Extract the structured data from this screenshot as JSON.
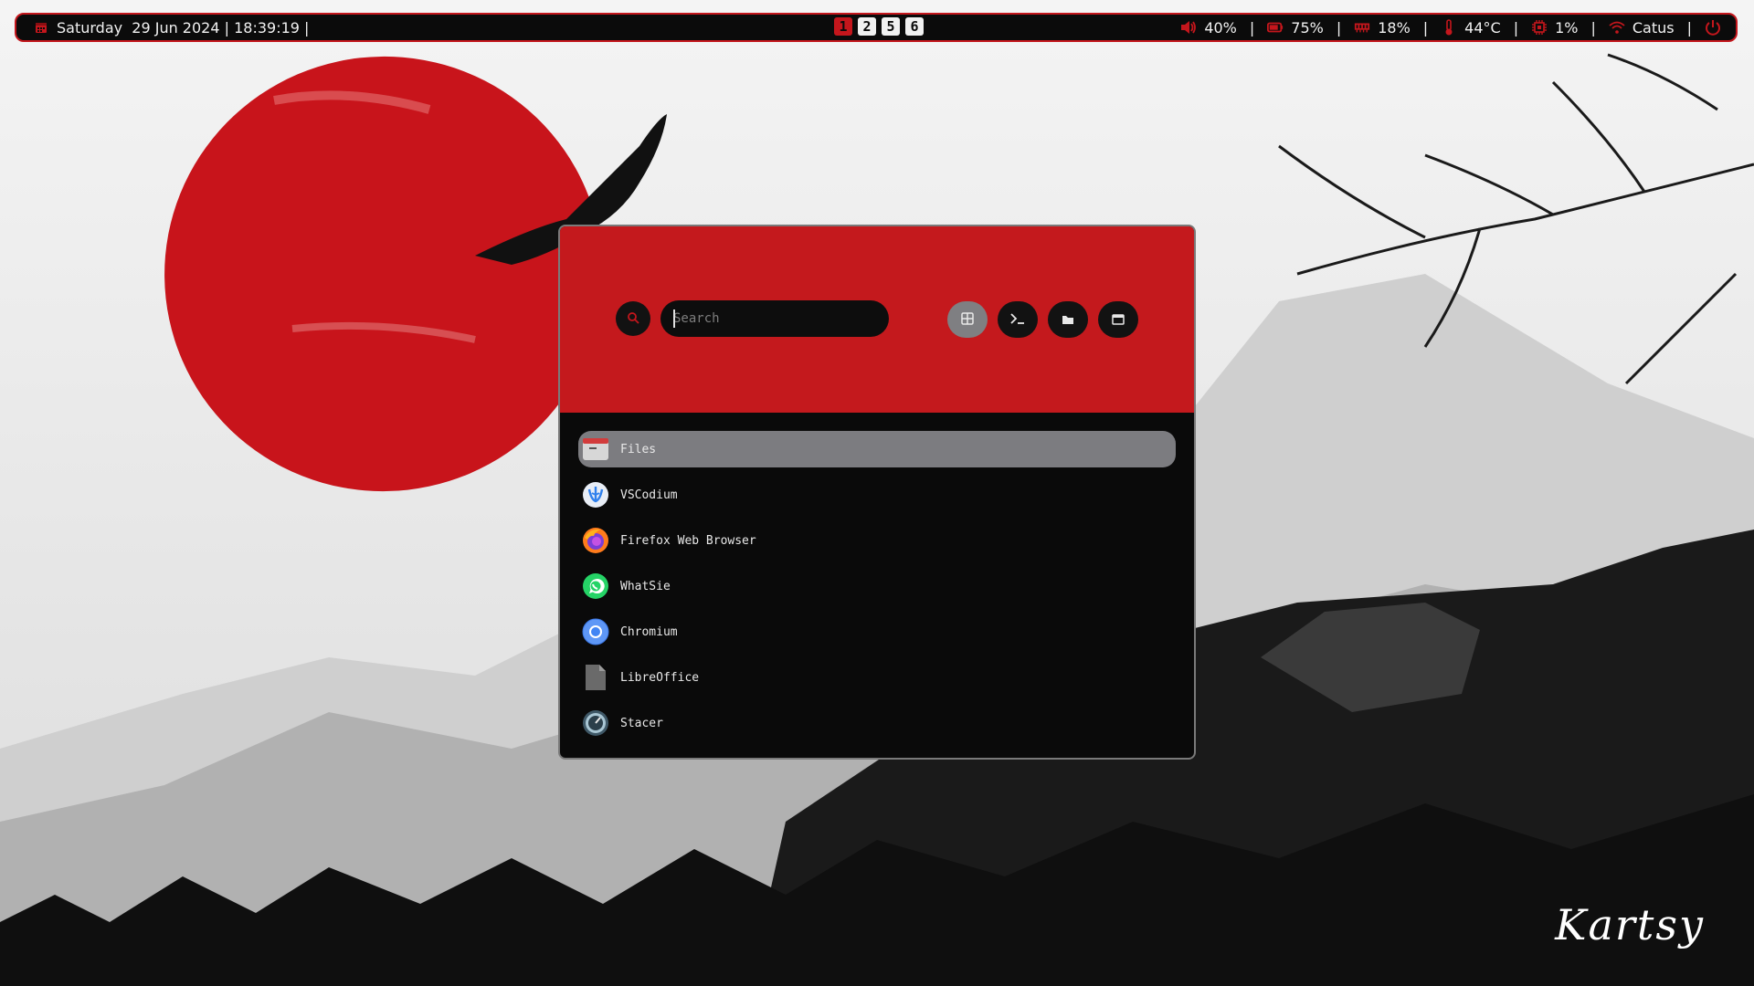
{
  "wallpaper": {
    "signature": "Kartsy"
  },
  "topbar": {
    "calendar_icon": "calendar-icon",
    "date": "Saturday  29 Jun 2024 | 18:39:19 |",
    "workspaces": [
      {
        "label": "1",
        "active": true
      },
      {
        "label": "2",
        "active": false
      },
      {
        "label": "5",
        "active": false
      },
      {
        "label": "6",
        "active": false
      }
    ],
    "volume": {
      "icon": "speaker-icon",
      "value": "40%"
    },
    "battery": {
      "icon": "battery-icon",
      "value": "75%"
    },
    "memory": {
      "icon": "memory-icon",
      "value": "18%"
    },
    "temperature": {
      "icon": "thermometer-icon",
      "value": "44°C"
    },
    "cpu": {
      "icon": "cpu-icon",
      "value": "1%"
    },
    "network": {
      "icon": "wifi-icon",
      "value": "Catus"
    },
    "power": {
      "icon": "power-icon"
    },
    "separator": "|"
  },
  "launcher": {
    "search": {
      "placeholder": "Search",
      "value": ""
    },
    "modes": [
      {
        "name": "apps",
        "icon": "grid-icon",
        "selected": true
      },
      {
        "name": "run",
        "icon": "terminal-icon",
        "selected": false
      },
      {
        "name": "files",
        "icon": "folder-icon",
        "selected": false
      },
      {
        "name": "windows",
        "icon": "window-icon",
        "selected": false
      }
    ],
    "apps": [
      {
        "label": "Files",
        "icon": "files-icon",
        "selected": true
      },
      {
        "label": "VSCodium",
        "icon": "vscodium-icon",
        "selected": false
      },
      {
        "label": "Firefox Web Browser",
        "icon": "firefox-icon",
        "selected": false
      },
      {
        "label": "WhatSie",
        "icon": "whatsapp-icon",
        "selected": false
      },
      {
        "label": "Chromium",
        "icon": "chromium-icon",
        "selected": false
      },
      {
        "label": "LibreOffice",
        "icon": "libreoffice-icon",
        "selected": false
      },
      {
        "label": "Stacer",
        "icon": "stacer-icon",
        "selected": false
      }
    ]
  },
  "colors": {
    "accent": "#c4161c",
    "bar_bg": "#0b0b0b",
    "launcher_bg": "#0a0a0a",
    "selection": "#7c7c80"
  }
}
